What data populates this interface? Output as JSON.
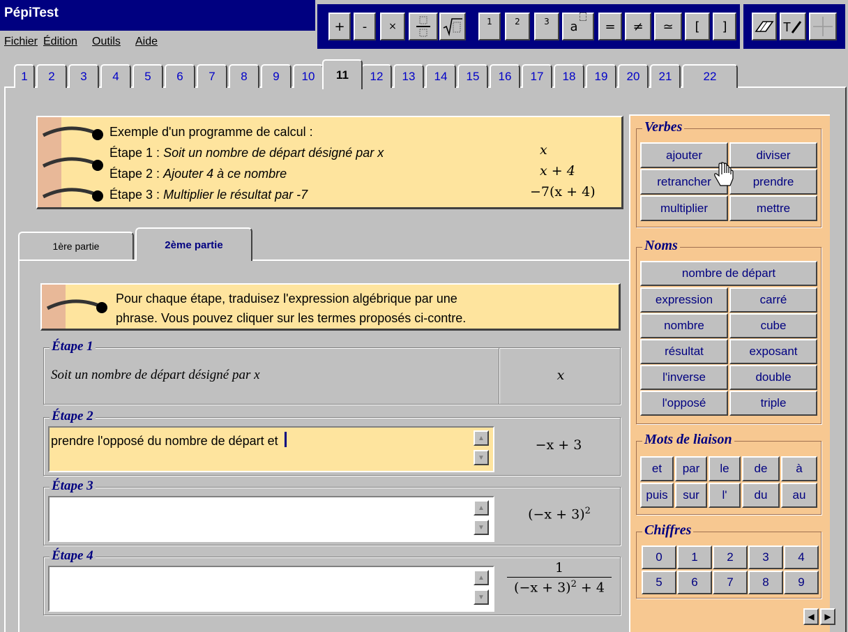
{
  "app": {
    "title": "PépiTest"
  },
  "menu": [
    {
      "label": "Fichier"
    },
    {
      "label": "Édition"
    },
    {
      "label": "Outils"
    },
    {
      "label": "Aide"
    }
  ],
  "toolbar": {
    "math_buttons": [
      {
        "icon": "plus-icon",
        "glyph": "+"
      },
      {
        "icon": "minus-icon",
        "glyph": "-"
      },
      {
        "icon": "times-icon",
        "glyph": "×"
      },
      {
        "icon": "fraction-icon",
        "glyph": ""
      },
      {
        "icon": "square-root-icon",
        "glyph": "√"
      },
      {
        "icon": "exponent-1-icon",
        "glyph": "1"
      },
      {
        "icon": "exponent-2-icon",
        "glyph": "2"
      },
      {
        "icon": "exponent-3-icon",
        "glyph": "3"
      },
      {
        "icon": "power-icon",
        "glyph": "a"
      },
      {
        "icon": "equals-icon",
        "glyph": "="
      },
      {
        "icon": "not-equal-icon",
        "glyph": "≠"
      },
      {
        "icon": "approx-icon",
        "glyph": "≃"
      },
      {
        "icon": "open-bracket-icon",
        "glyph": "["
      },
      {
        "icon": "close-bracket-icon",
        "glyph": "]"
      }
    ],
    "tool_buttons": [
      {
        "icon": "eraser-icon"
      },
      {
        "icon": "text-pen-icon"
      },
      {
        "icon": "crosshair-icon"
      }
    ]
  },
  "tabs": [
    "1",
    "2",
    "3",
    "4",
    "5",
    "6",
    "7",
    "8",
    "9",
    "10",
    "11",
    "12",
    "13",
    "14",
    "15",
    "16",
    "17",
    "18",
    "19",
    "20",
    "21",
    "22"
  ],
  "active_tab": "11",
  "example": {
    "intro": "Exemple d'un programme de calcul :",
    "steps": [
      {
        "label": "Étape 1 : ",
        "text": "Soit un nombre de départ désigné par x",
        "expr": "x"
      },
      {
        "label": "Étape 2 : ",
        "text": "Ajouter 4 à ce nombre",
        "expr": "x + 4"
      },
      {
        "label": "Étape 3 : ",
        "text": "Multiplier le résultat par -7",
        "expr": "−7(x + 4)"
      }
    ]
  },
  "part_tabs": [
    {
      "label": "1ère partie"
    },
    {
      "label": "2ème partie",
      "active": true
    }
  ],
  "instruction": {
    "line1": "Pour chaque étape, traduisez l'expression algébrique par une",
    "line2": "phrase. Vous pouvez cliquer sur les termes proposés ci-contre."
  },
  "etapes": [
    {
      "title": "Étape 1",
      "text": "Soit un nombre de départ désigné par x",
      "expr": "x"
    },
    {
      "title": "Étape 2",
      "text": "prendre l'opposé du nombre de départ et ",
      "expr": "−x + 3"
    },
    {
      "title": "Étape 3",
      "text": "",
      "expr": "(−x + 3)",
      "expr_sup": "2"
    },
    {
      "title": "Étape 4",
      "text": "",
      "expr_num": "1",
      "expr_den": "(−x + 3)",
      "expr_den_sup": "2",
      "expr_den_tail": " + 4"
    }
  ],
  "panel": {
    "verbes": {
      "title": "Verbes",
      "words": [
        "ajouter",
        "diviser",
        "retrancher",
        "prendre",
        "multiplier",
        "mettre"
      ]
    },
    "noms": {
      "title": "Noms",
      "words": [
        "nombre de départ",
        "expression",
        "carré",
        "nombre",
        "cube",
        "résultat",
        "exposant",
        "l'inverse",
        "double",
        "l'opposé",
        "triple"
      ]
    },
    "liaison": {
      "title": "Mots de liaison",
      "words": [
        "et",
        "par",
        "le",
        "de",
        "à",
        "puis",
        "sur",
        "l'",
        "du",
        "au"
      ]
    },
    "chiffres": {
      "title": "Chiffres",
      "words": [
        "0",
        "1",
        "2",
        "3",
        "4",
        "5",
        "6",
        "7",
        "8",
        "9"
      ]
    }
  },
  "colors": {
    "titlebar": "#000080",
    "note": "#fee49e",
    "panel": "#f7c891",
    "link": "#0000c8"
  }
}
